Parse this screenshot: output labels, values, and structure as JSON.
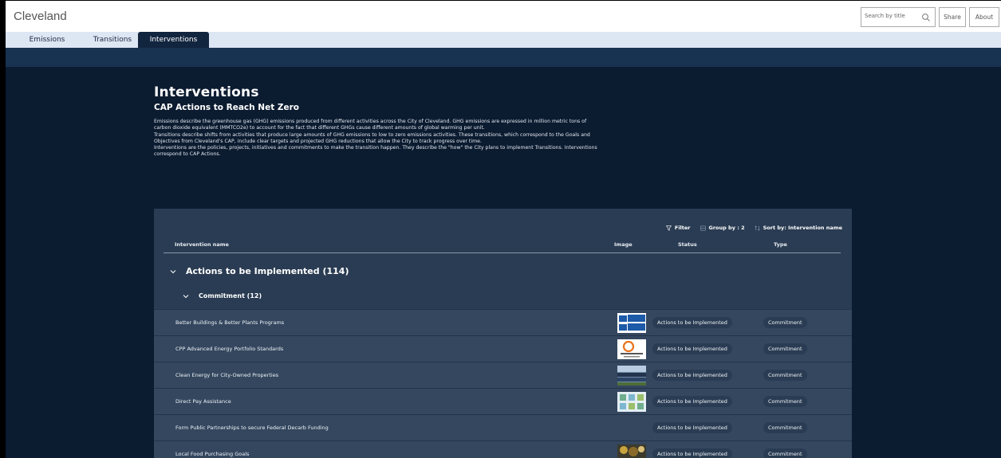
{
  "app": {
    "title": "Cleveland"
  },
  "header": {
    "search_placeholder": "Search by title",
    "share_label": "Share",
    "about_label": "About"
  },
  "tabs": [
    {
      "label": "Emissions",
      "active": false
    },
    {
      "label": "Transitions",
      "active": false
    },
    {
      "label": "Interventions",
      "active": true
    }
  ],
  "page": {
    "title": "Interventions",
    "subtitle": "CAP Actions to Reach Net Zero",
    "paragraphs": [
      "Emissions describe the greenhouse gas (GHG) emissions produced from different activities across the City of Cleveland. GHG emissions are expressed in million metric tons of carbon dioxide equivalent (MMTCO2e) to account for the fact that different GHGs cause different amounts of global warming per unit.",
      "Transitions describe shifts from activities that produce large amounts of GHG emissions to low to zero emissions activities. These transitions, which correspond to the Goals and Objectives from Cleveland's CAP, include clear targets and projected GHG reductions that allow the City to track progress over time.",
      "Interventions are the policies, projects, initiatives and commitments to make the transition happen. They describe the \"how\" the City plans to implement Transitions. Interventions correspond to CAP Actions."
    ]
  },
  "table": {
    "toolbar": {
      "filter_label": "Filter",
      "group_label": "Group by : 2",
      "sort_label": "Sort by: Intervention name"
    },
    "columns": [
      "Intervention name",
      "Image",
      "Status",
      "Type"
    ],
    "group": {
      "label": "Actions to be Implemented (114)"
    },
    "subgroup": {
      "label": "Commitment (12)"
    },
    "rows": [
      {
        "name": "Better Buildings & Better Plants Programs",
        "image": "better-plants-logo",
        "status": "Actions to be Implemented",
        "type": "Commitment"
      },
      {
        "name": "CPP Advanced Energy Portfolio Standards",
        "image": "cpp-logo",
        "status": "Actions to be Implemented",
        "type": "Commitment"
      },
      {
        "name": "Clean Energy for City-Owned Properties",
        "image": "solar-panels-photo",
        "status": "Actions to be Implemented",
        "type": "Commitment"
      },
      {
        "name": "Direct Pay Assistance",
        "image": "direct-pay-graphic",
        "status": "Actions to be Implemented",
        "type": "Commitment"
      },
      {
        "name": "Form Public Partnerships to secure Federal Decarb Funding",
        "image": "",
        "status": "Actions to be Implemented",
        "type": "Commitment"
      },
      {
        "name": "Local Food Purchasing Goals",
        "image": "food-photo",
        "status": "Actions to be Implemented",
        "type": "Commitment"
      }
    ]
  },
  "colors": {
    "page_bg": "#0b1b30",
    "panel_bg": "#2a3c53",
    "row_bg": "#34475f",
    "tab_bar_bg": "#dde6f3",
    "active_tab_bg": "#12253f"
  }
}
